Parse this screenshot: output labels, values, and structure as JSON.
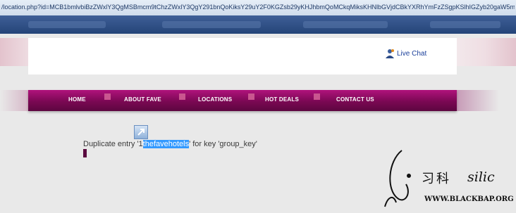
{
  "browser": {
    "url": "/location.php?id=MCB1bmlvbiBzZWxlY3QgMSBmcm9tChzZWxlY3QgY291bnQoKiksY29uY2F0KGZsb29yKHJhbmQoMCkqMiksKHNlbGVjdCBkYXRhYmFzZSgpKSlhIGZyb20gaW5m"
  },
  "header": {
    "live_chat_label": "Live Chat"
  },
  "nav": {
    "items": [
      "HOME",
      "ABOUT FAVE",
      "LOCATIONS",
      "HOT DEALS",
      "CONTACT US"
    ]
  },
  "error": {
    "prefix": "Duplicate entry '1",
    "highlight": "thefavehotels",
    "suffix": "' for key 'group_key'"
  },
  "watermark": {
    "cn_text": "习科",
    "en_text": "silic",
    "site": "WWW.BLACKBAP.ORG"
  }
}
